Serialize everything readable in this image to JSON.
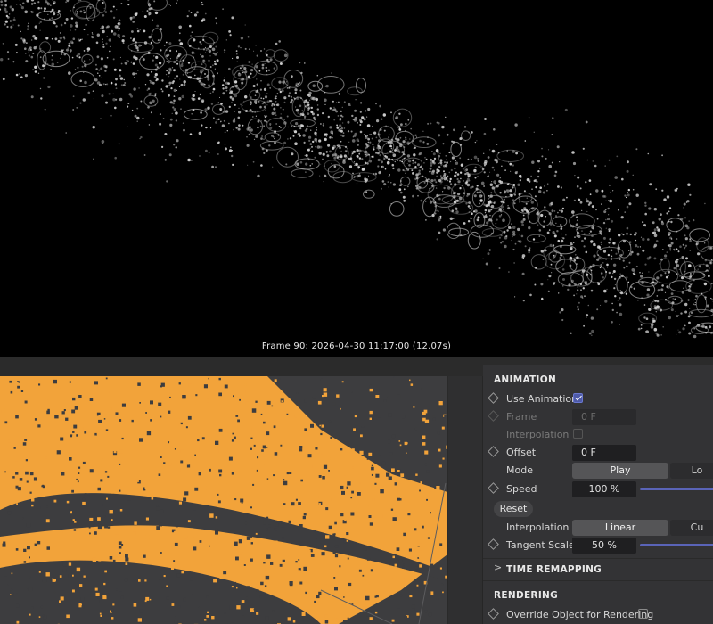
{
  "render_view": {
    "caption": "Frame  90:  2026-04-30  11:17:00  (12.07s)"
  },
  "panel": {
    "animation": {
      "title": "ANIMATION",
      "use_animation_label": "Use Animation",
      "use_animation_checked": true,
      "frame_label": "Frame",
      "frame_value": "0 F",
      "interpolation_label": "Interpolation",
      "offset_label": "Offset",
      "offset_value": "0 F",
      "mode_label": "Mode",
      "mode_options": [
        "Play",
        "Lo"
      ],
      "mode_selected": "Play",
      "speed_label": "Speed",
      "speed_value": "100 %",
      "reset_label": "Reset",
      "interp_label": "Interpolation",
      "interp_options": [
        "Linear",
        "Cu"
      ],
      "interp_selected": "Linear",
      "tangent_label": "Tangent Scale",
      "tangent_value": "50 %"
    },
    "time_remapping": {
      "title": "TIME REMAPPING",
      "icon": "chevron-right-icon"
    },
    "rendering": {
      "title": "RENDERING",
      "override_label": "Override Object for Rendering",
      "override_checked": false
    }
  },
  "colors": {
    "particles_orange": "#f2a33a",
    "viewport_bg": "#3d3d3f",
    "panel_bg": "#333335",
    "accent_blue": "#5a64b8"
  }
}
